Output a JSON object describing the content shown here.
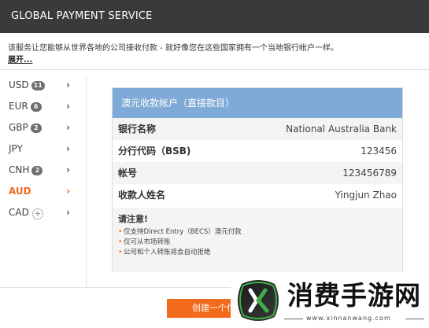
{
  "header": {
    "title": "GLOBAL PAYMENT SERVICE"
  },
  "intro": {
    "text": "该服务让您能够从世界各地的公司接收付款 - 就好像您在这些国家拥有一个当地银行帐户一样。",
    "expand_link": "展开..."
  },
  "sidebar": {
    "items": [
      {
        "code": "USD",
        "badge": "11",
        "chevron": "›"
      },
      {
        "code": "EUR",
        "badge": "6",
        "chevron": "›"
      },
      {
        "code": "GBP",
        "badge": "2",
        "chevron": "›"
      },
      {
        "code": "JPY",
        "badge": "",
        "chevron": "›"
      },
      {
        "code": "CNH",
        "badge": "2",
        "chevron": "›"
      },
      {
        "code": "AUD",
        "badge": "",
        "chevron": "›",
        "active": true
      },
      {
        "code": "CAD",
        "badge": "",
        "plus": "+",
        "chevron": "›"
      }
    ]
  },
  "account": {
    "header": "澳元收款帐户（直接款目）",
    "rows": [
      {
        "label": "银行名称",
        "value": "National Australia Bank"
      },
      {
        "label": "分行代码（BSB)",
        "value": "123456"
      },
      {
        "label": "帐号",
        "value": "123456789"
      },
      {
        "label": "收款人姓名",
        "value": "Yingjun Zhao"
      }
    ],
    "notes": {
      "title": "请注意!",
      "bullet": "•",
      "items": [
        "仅支持Direct Entry（BECS）澳元付款",
        "仅可从市场转账",
        "公司和个人转账将会自动拒绝"
      ]
    }
  },
  "footer": {
    "create_button": "创建一个付款"
  },
  "watermark": {
    "brand": "消费手游网",
    "url": "www.xinnanwang.com"
  },
  "colors": {
    "header_bg": "#3a3a3a",
    "accent": "#f26a1b",
    "card_header": "#7fa9d6",
    "badge": "#6e6e6e"
  }
}
